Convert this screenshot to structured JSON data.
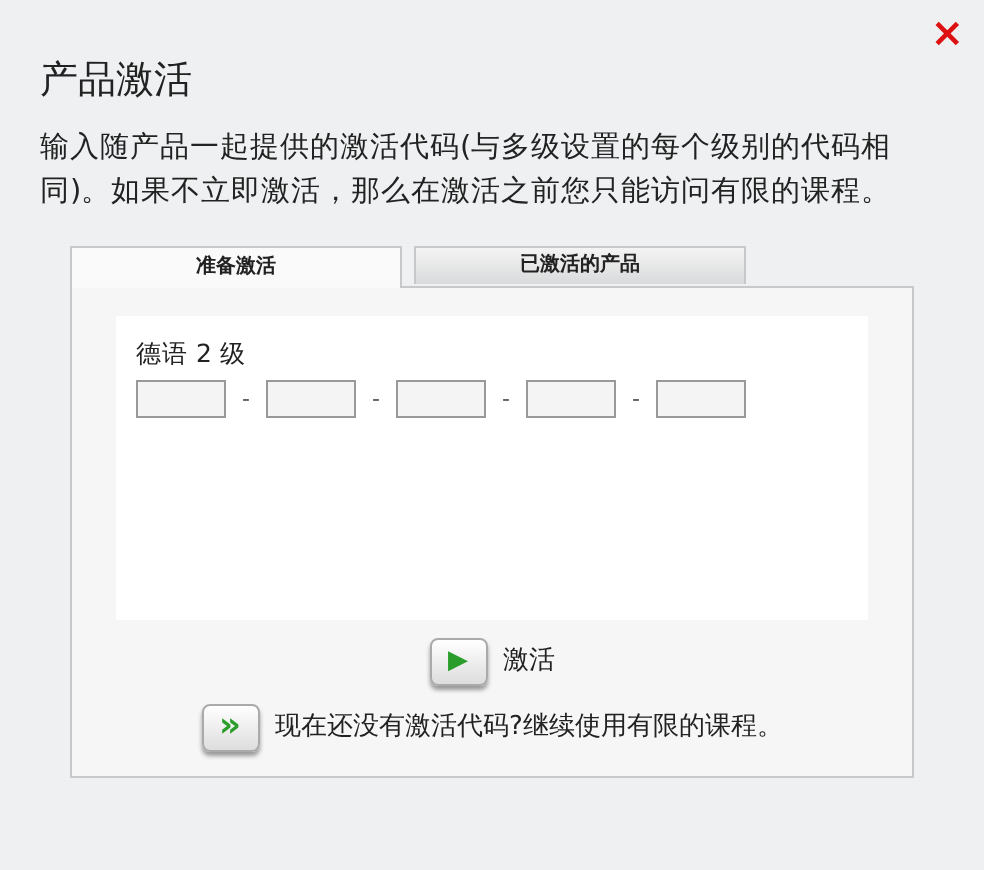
{
  "dialog": {
    "close": "×",
    "title": "产品激活",
    "description": "输入随产品一起提供的激活代码(与多级设置的每个级别的代码相同)。如果不立即激活，那么在激活之前您只能访问有限的课程。"
  },
  "tabs": [
    {
      "label": "准备激活",
      "selected": true
    },
    {
      "label": "已激活的产品",
      "selected": false
    }
  ],
  "product": {
    "name": "德语 2 级",
    "separators": [
      "-",
      "-",
      "-",
      "-"
    ]
  },
  "activate_button": {
    "icon": "▶",
    "label": "激活"
  },
  "continue_link": {
    "icon": "»",
    "label": "现在还没有激活代码?继续使用有限的课程。"
  }
}
